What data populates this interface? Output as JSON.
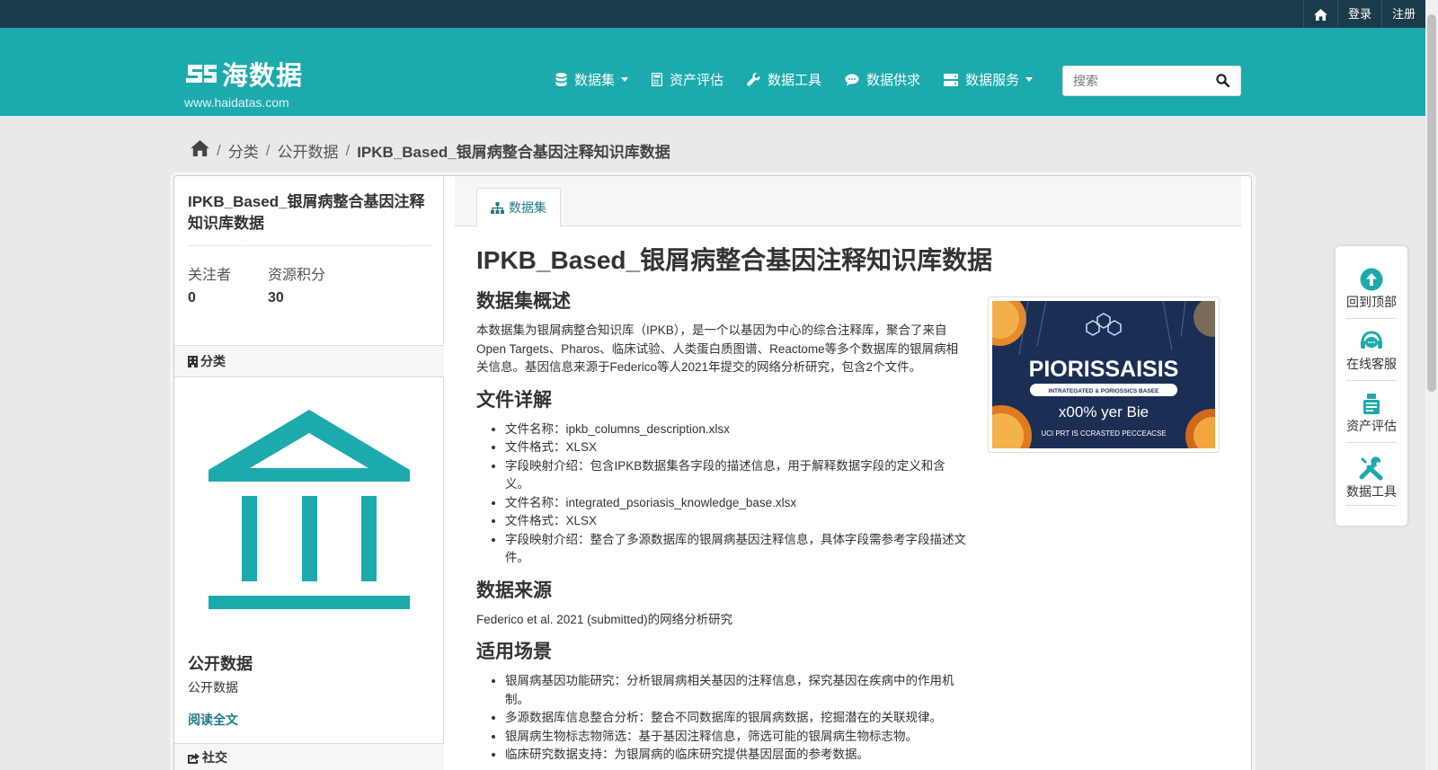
{
  "topbar": {
    "login": "登录",
    "register": "注册"
  },
  "header": {
    "logo_text": "海数据",
    "logo_url": "www.haidatas.com",
    "nav": [
      {
        "label": "数据集",
        "icon": "database-icon",
        "dropdown": true
      },
      {
        "label": "资产评估",
        "icon": "calculator-icon",
        "dropdown": false
      },
      {
        "label": "数据工具",
        "icon": "wrench-icon",
        "dropdown": false
      },
      {
        "label": "数据供求",
        "icon": "comment-icon",
        "dropdown": false
      },
      {
        "label": "数据服务",
        "icon": "server-icon",
        "dropdown": true
      }
    ],
    "search_placeholder": "搜索"
  },
  "breadcrumb": {
    "item1": "分类",
    "item2": "公开数据",
    "current": "IPKB_Based_银屑病整合基因注释知识库数据"
  },
  "sidebar": {
    "title": "IPKB_Based_银屑病整合基因注释知识库数据",
    "followers_label": "关注者",
    "followers_value": "0",
    "points_label": "资源积分",
    "points_value": "30",
    "category_heading": "分类",
    "org_name": "公开数据",
    "org_desc": "公开数据",
    "read_more": "阅读全文",
    "social_heading": "社交"
  },
  "tabs": {
    "dataset": "数据集"
  },
  "content": {
    "title": "IPKB_Based_银屑病整合基因注释知识库数据",
    "overview_heading": "数据集概述",
    "overview_text": "本数据集为银屑病整合知识库（IPKB），是一个以基因为中心的综合注释库，聚合了来自Open Targets、Pharos、临床试验、人类蛋白质图谱、Reactome等多个数据库的银屑病相关信息。基因信息来源于Federico等人2021年提交的网络分析研究，包含2个文件。",
    "files_heading": "文件详解",
    "files": [
      "文件名称：ipkb_columns_description.xlsx",
      "文件格式：XLSX",
      "字段映射介绍：包含IPKB数据集各字段的描述信息，用于解释数据字段的定义和含义。",
      "文件名称：integrated_psoriasis_knowledge_base.xlsx",
      "文件格式：XLSX",
      "字段映射介绍：整合了多源数据库的银屑病基因注释信息，具体字段需参考字段描述文件。"
    ],
    "source_heading": "数据来源",
    "source_text": "Federico et al. 2021 (submitted)的网络分析研究",
    "usage_heading": "适用场景",
    "usage": [
      "银屑病基因功能研究：分析银屑病相关基因的注释信息，探究基因在疾病中的作用机制。",
      "多源数据库信息整合分析：整合不同数据库的银屑病数据，挖掘潜在的关联规律。",
      "银屑病生物标志物筛选：基于基因注释信息，筛选可能的银屑病生物标志物。",
      "临床研究数据支持：为银屑病的临床研究提供基因层面的参考数据。"
    ],
    "image_text": {
      "title": "PIORISSAISIS",
      "banner": "INTRATEGATED & PORIOSSICS BASEE",
      "line1": "x00% yer Bie",
      "line2": "UCI PRT IS CCRASTED PECCEACSE"
    }
  },
  "float_panel": {
    "top": "回到顶部",
    "service": "在线客服",
    "assess": "资产评估",
    "tools": "数据工具"
  },
  "colors": {
    "topbar": "#1c3b4a",
    "header": "#1caaad",
    "accent": "#1f7a8c",
    "icon_teal": "#1caaad"
  }
}
